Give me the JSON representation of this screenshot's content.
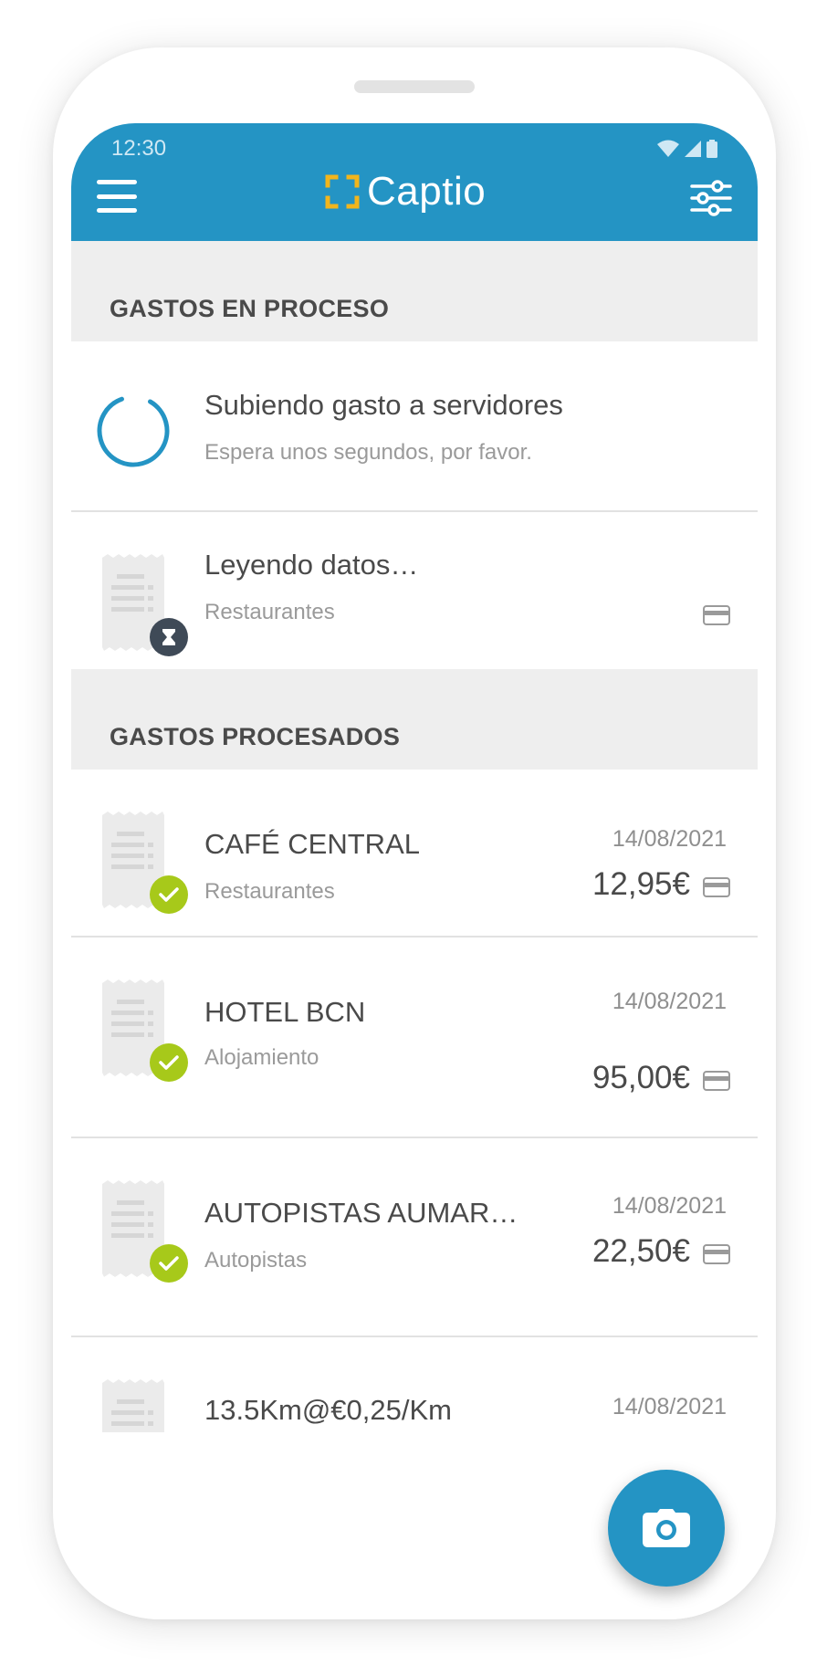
{
  "status_bar": {
    "time": "12:30"
  },
  "header": {
    "app_name": "Captio",
    "brand_color": "#2494c4",
    "logo_accent": "#f2b51c"
  },
  "sections": {
    "in_process": "GASTOS EN PROCESO",
    "processed": "GASTOS PROCESADOS"
  },
  "in_process_items": [
    {
      "title": "Subiendo gasto a servidores",
      "subtitle": "Espera unos segundos, por favor."
    },
    {
      "title": "Leyendo datos…",
      "subtitle": "Restaurantes"
    }
  ],
  "processed_items": [
    {
      "title": "CAFÉ CENTRAL",
      "category": "Restaurantes",
      "date": "14/08/2021",
      "amount": "12,95€"
    },
    {
      "title": "HOTEL BCN",
      "category": "Alojamiento",
      "date": "14/08/2021",
      "amount": "95,00€"
    },
    {
      "title": "AUTOPISTAS AUMAR…",
      "category": "Autopistas",
      "date": "14/08/2021",
      "amount": "22,50€"
    },
    {
      "title": "13.5Km@€0,25/Km",
      "date": "14/08/2021"
    }
  ],
  "icons": {
    "menu": "menu-icon",
    "filter": "filter-icon",
    "spinner": "spinner-icon",
    "receipt": "receipt-icon",
    "check": "check-icon",
    "hourglass": "hourglass-icon",
    "card": "credit-card-icon",
    "camera": "camera-icon"
  },
  "colors": {
    "ok_badge": "#a7c91a",
    "pending_badge": "#3f4a57"
  }
}
